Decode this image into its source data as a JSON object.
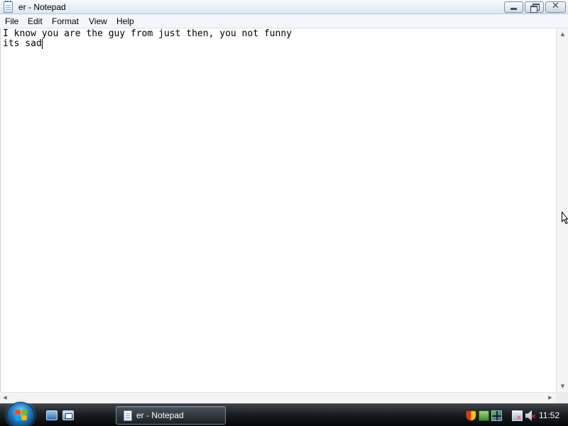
{
  "window": {
    "title": "er - Notepad"
  },
  "caption_buttons": {
    "close_glyph": "✕"
  },
  "menu": {
    "items": [
      "File",
      "Edit",
      "Format",
      "View",
      "Help"
    ]
  },
  "editor": {
    "lines": [
      "I know you are the guy from just then, you not funny",
      "its sad"
    ]
  },
  "scrollbars": {
    "up_arrow": "▲",
    "down_arrow": "▼",
    "left_arrow": "◀",
    "right_arrow": "▶"
  },
  "taskbar": {
    "task_label": "er - Notepad",
    "clock": "11:52",
    "network_status_glyph": "✕",
    "volume_status_glyph": "✕"
  },
  "icons": [
    "notepad-icon",
    "minimize-icon",
    "maximize-icon",
    "close-icon",
    "start-orb-icon",
    "show-desktop-icon",
    "switch-windows-icon",
    "windows-defender-icon",
    "security-center-icon",
    "network-icon",
    "volume-muted-icon"
  ],
  "colors": {
    "titlebar_top": "#f7fafd",
    "titlebar_bottom": "#dde7f2",
    "menubar_bg": "#f3f7fb",
    "taskbar_bg": "#1b1e22",
    "start_orb": "#2e8ad0"
  }
}
